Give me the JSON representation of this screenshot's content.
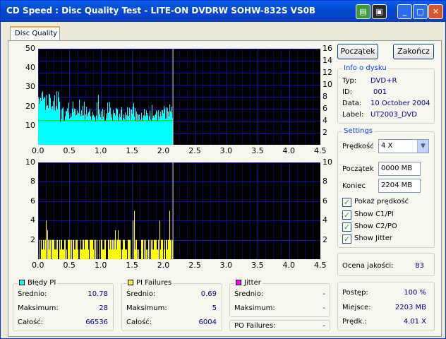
{
  "window": {
    "title": "CD Speed : Disc Quality Test - LITE-ON DVDRW SOHW-832S  VS0B"
  },
  "tab": {
    "label": "Disc Quality"
  },
  "buttons": {
    "start": "Początek",
    "exit": "Zakończ"
  },
  "disc_info": {
    "title": "Info o dysku",
    "rows": [
      {
        "label": "Typ:",
        "value": "DVD+R"
      },
      {
        "label": "ID:",
        "value": "001"
      },
      {
        "label": "Data:",
        "value": "10 October 2004"
      },
      {
        "label": "Label:",
        "value": "UT2003_DVD"
      }
    ]
  },
  "settings": {
    "title": "Settings",
    "speed_label": "Prędkość",
    "speed_value": "4 X",
    "start_label": "Początek",
    "start_value": "0000 MB",
    "end_label": "Koniec",
    "end_value": "2204 MB",
    "checkboxes": [
      {
        "label": "Pokaż prędkość",
        "checked": true
      },
      {
        "label": "Show C1/PI",
        "checked": true
      },
      {
        "label": "Show C2/PO",
        "checked": true
      },
      {
        "label": "Show Jitter",
        "checked": true
      }
    ]
  },
  "quality": {
    "label": "Ocena jakości:",
    "value": "83"
  },
  "progress": {
    "rows": [
      {
        "label": "Postęp:",
        "value": "100 %"
      },
      {
        "label": "Miejsce:",
        "value": "2203 MB"
      },
      {
        "label": "Prędk.:",
        "value": "4.01 X"
      }
    ]
  },
  "stats": {
    "pi_errors": {
      "title": "Błędy PI",
      "color": "#00ffff",
      "rows": [
        {
          "label": "Średnio:",
          "value": "10.78"
        },
        {
          "label": "Maksimum:",
          "value": "28"
        },
        {
          "label": "Całość:",
          "value": "66536"
        }
      ]
    },
    "pi_failures": {
      "title": "PI Failures",
      "color": "#ffff00",
      "rows": [
        {
          "label": "Średnio:",
          "value": "0.69"
        },
        {
          "label": "Maksimum:",
          "value": "5"
        },
        {
          "label": "Całość:",
          "value": "6004"
        }
      ]
    },
    "jitter": {
      "title": "Jitter",
      "color": "#ff00ff",
      "rows": [
        {
          "label": "Średnio:",
          "value": "-"
        },
        {
          "label": "Maksimum:",
          "value": "-"
        }
      ],
      "po_label": "PO Failures:",
      "po_value": "-"
    }
  },
  "chart_data": [
    {
      "type": "area",
      "x_ticks": [
        "0.0",
        "0.5",
        "1.0",
        "1.5",
        "2.0",
        "2.5",
        "3.0",
        "3.5",
        "4.0",
        "4.5"
      ],
      "y_left_ticks": [
        "50",
        "40",
        "30",
        "20",
        "10"
      ],
      "y_right_ticks": [
        "16",
        "14",
        "12",
        "10",
        "8",
        "6",
        "4",
        "2"
      ],
      "xlim": [
        0,
        4.5
      ],
      "ylim": [
        0,
        50
      ],
      "y2lim": [
        0,
        16
      ],
      "grid": true,
      "series": [
        {
          "color": "#00ffff",
          "x_end": 2.15,
          "avg": 10.78,
          "max": 28
        },
        {
          "color": "#00c000",
          "value": 4.01,
          "axis": "right"
        }
      ],
      "marker_x": 2.15
    },
    {
      "type": "bar",
      "x_ticks": [
        "0.0",
        "0.5",
        "1.0",
        "1.5",
        "2.0",
        "2.5",
        "3.0",
        "3.5",
        "4.0",
        "4.5"
      ],
      "y_left_ticks": [
        "10",
        "8",
        "6",
        "4",
        "2"
      ],
      "y_right_ticks": [
        "10",
        "8",
        "6",
        "4",
        "2"
      ],
      "xlim": [
        0,
        4.5
      ],
      "ylim": [
        0,
        10
      ],
      "grid": true,
      "series": [
        {
          "color": "#ffff00",
          "x_end": 2.15,
          "max": 5
        }
      ],
      "marker_x": 2.15
    }
  ]
}
